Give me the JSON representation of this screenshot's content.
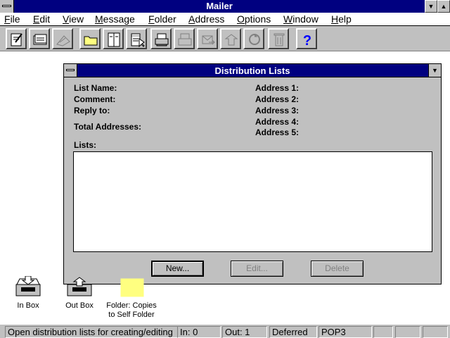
{
  "window": {
    "title": "Mailer"
  },
  "menu": [
    "File",
    "Edit",
    "View",
    "Message",
    "Folder",
    "Address",
    "Options",
    "Window",
    "Help"
  ],
  "toolbar": {
    "buttons": [
      {
        "icon": "compose-icon"
      },
      {
        "icon": "read-mail-icon"
      },
      {
        "icon": "reply-icon"
      },
      {
        "icon": "folder-icon"
      },
      {
        "icon": "address-book-icon"
      },
      {
        "icon": "notepad-icon"
      },
      {
        "icon": "print-icon"
      },
      {
        "icon": "print-setup-icon"
      },
      {
        "icon": "forward-icon"
      },
      {
        "icon": "move-icon"
      },
      {
        "icon": "copy-icon"
      },
      {
        "icon": "delete-icon"
      },
      {
        "icon": "help-icon",
        "label": "?"
      }
    ]
  },
  "dialog": {
    "title": "Distribution Lists",
    "fields": {
      "list_name": "List Name:",
      "comment": "Comment:",
      "reply_to": "Reply to:",
      "total_addresses": "Total Addresses:",
      "address1": "Address 1:",
      "address2": "Address 2:",
      "address3": "Address 3:",
      "address4": "Address 4:",
      "address5": "Address 5:",
      "lists": "Lists:"
    },
    "buttons": {
      "new": "New...",
      "edit": "Edit...",
      "delete": "Delete"
    }
  },
  "desktop": {
    "icons": [
      {
        "label": "In Box"
      },
      {
        "label": "Out Box"
      },
      {
        "label": "Folder: Copies to Self Folder"
      }
    ]
  },
  "status": {
    "message": "Open distribution lists for creating/editing",
    "in": "In:  0",
    "out": "Out: 1",
    "state": "Deferred",
    "protocol": "POP3"
  },
  "colors": {
    "titlebar": "#000080",
    "face": "#c0c0c0",
    "folder": "#ffff80"
  }
}
